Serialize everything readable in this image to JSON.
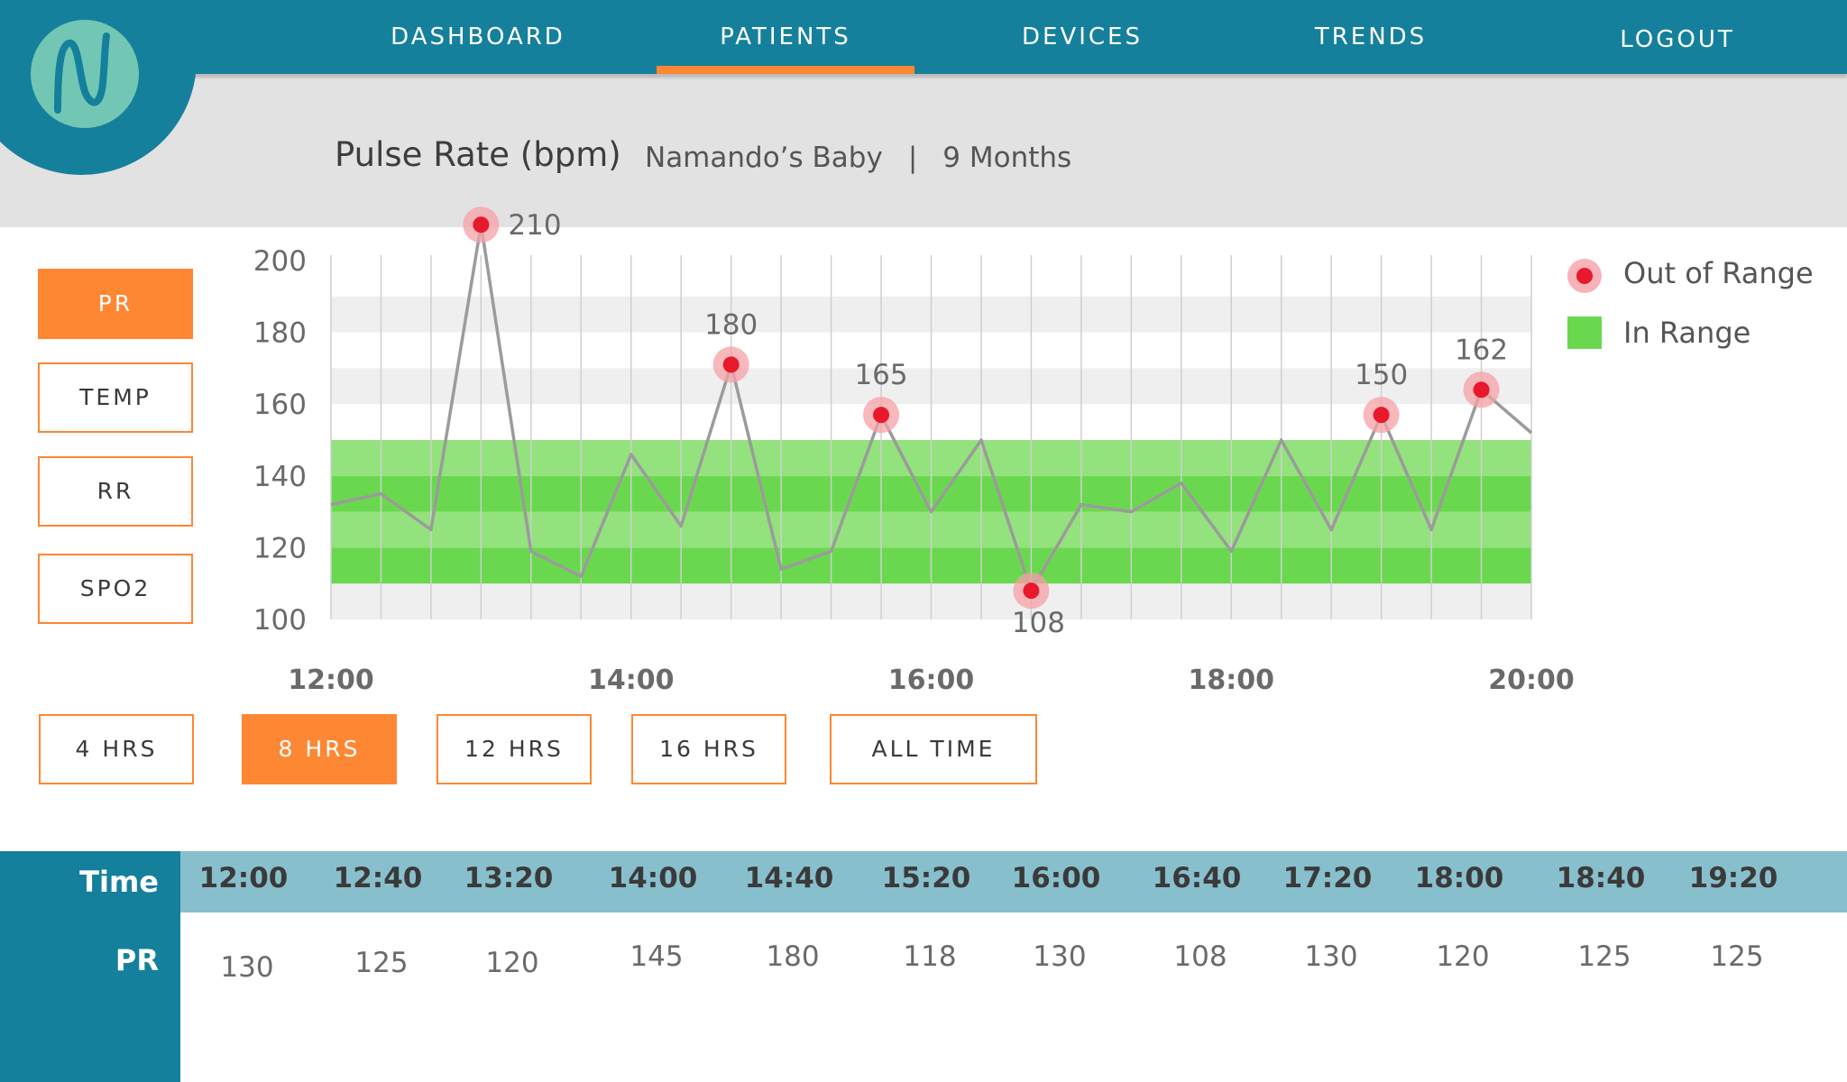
{
  "nav": {
    "items": [
      {
        "label": "DASHBOARD"
      },
      {
        "label": "PATIENTS",
        "active": true
      },
      {
        "label": "DEVICES"
      },
      {
        "label": "TRENDS"
      },
      {
        "label": "LOGOUT"
      }
    ]
  },
  "logo": {
    "icon": "wave-n-logo-icon"
  },
  "header": {
    "title": "Pulse Rate (bpm)",
    "patient": "Namando’s Baby",
    "separator": "|",
    "age": "9 Months"
  },
  "metrics": [
    {
      "label": "PR",
      "active": true
    },
    {
      "label": "TEMP"
    },
    {
      "label": "RR"
    },
    {
      "label": "SPO2"
    }
  ],
  "ranges": [
    {
      "label": "4 HRS"
    },
    {
      "label": "8 HRS",
      "active": true
    },
    {
      "label": "12 HRS"
    },
    {
      "label": "16 HRS"
    },
    {
      "label": "ALL TIME"
    }
  ],
  "legend": {
    "out_of_range": "Out of Range",
    "in_range": "In Range"
  },
  "colors": {
    "nav": "#15809c",
    "accent": "#fe8733",
    "in_range": "#6ad84e",
    "out_of_range": "#e8192c",
    "table_header": "#88bfcc"
  },
  "chart_data": {
    "type": "line",
    "title": "Pulse Rate (bpm)",
    "xlabel": "",
    "ylabel": "",
    "ylim": [
      100,
      200
    ],
    "yticks": [
      200,
      180,
      160,
      140,
      120,
      100
    ],
    "xlim": [
      "12:00",
      "20:00"
    ],
    "xticks": [
      "12:00",
      "14:00",
      "16:00",
      "18:00",
      "20:00"
    ],
    "in_range_band": [
      110,
      150
    ],
    "grid": true,
    "legend_position": "top-right",
    "series": [
      {
        "x": [
          "12:00",
          "12:20",
          "12:40",
          "13:00",
          "13:20",
          "13:40",
          "14:00",
          "14:20",
          "14:40",
          "15:00",
          "15:20",
          "15:40",
          "16:00",
          "16:20",
          "16:40",
          "17:00",
          "17:20",
          "17:40",
          "18:00",
          "18:20",
          "18:40",
          "19:00",
          "19:20",
          "19:40",
          "20:00"
        ],
        "values": [
          132,
          135,
          125,
          210,
          119,
          112,
          146,
          126,
          171,
          114,
          119,
          157,
          130,
          150,
          108,
          132,
          130,
          138,
          119,
          150,
          125,
          157,
          125,
          164,
          152
        ]
      }
    ],
    "out_of_range_points": [
      {
        "x": "13:00",
        "y": 210,
        "label": "210"
      },
      {
        "x": "14:40",
        "y": 171,
        "label": "180"
      },
      {
        "x": "15:40",
        "y": 157,
        "label": "165"
      },
      {
        "x": "16:40",
        "y": 108,
        "label": "108"
      },
      {
        "x": "19:00",
        "y": 157,
        "label": "150"
      },
      {
        "x": "19:40",
        "y": 164,
        "label": "162"
      }
    ]
  },
  "table": {
    "time_label": "Time",
    "pr_label": "PR",
    "times": [
      "12:00",
      "12:40",
      "13:20",
      "14:00",
      "14:40",
      "15:20",
      "16:00",
      "16:40",
      "17:20",
      "18:00",
      "18:40",
      "19:20"
    ],
    "pr_values": [
      "130",
      "125",
      "120",
      "145",
      "180",
      "118",
      "130",
      "108",
      "130",
      "120",
      "125",
      "125"
    ]
  }
}
